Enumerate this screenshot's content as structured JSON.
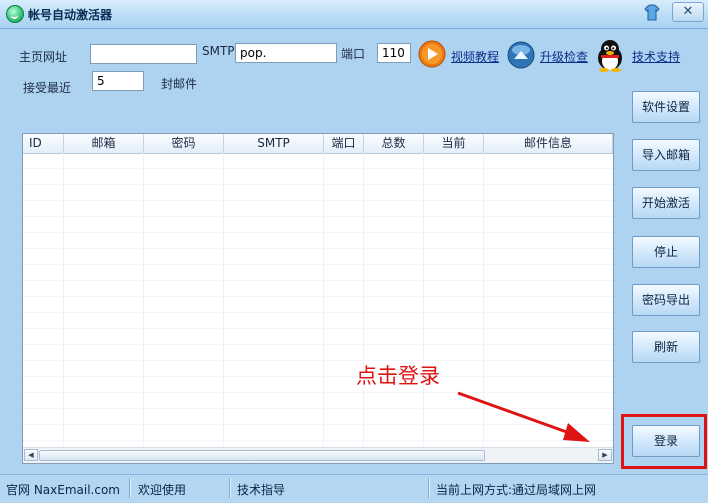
{
  "window": {
    "title": "帐号自动激活器",
    "close_label": "✕"
  },
  "form": {
    "homepage_label": "主页网址",
    "homepage_value": "",
    "smtp_label": "SMTP",
    "smtp_value": "pop.",
    "port_label": "端口",
    "port_value": "110",
    "receive_label": "接受最近",
    "receive_value": "5",
    "receive_unit": "封邮件"
  },
  "toolbar_links": {
    "video_tutorial": "视频教程",
    "upgrade_check": "升级检查",
    "tech_support": "技术支持"
  },
  "side_buttons": {
    "settings": "软件设置",
    "import": "导入邮箱",
    "start": "开始激活",
    "stop": "停止",
    "export": "密码导出",
    "refresh": "刷新",
    "login": "登录"
  },
  "grid": {
    "columns": [
      "ID",
      "邮箱",
      "密码",
      "SMTP",
      "端口",
      "总数",
      "当前",
      "邮件信息"
    ],
    "rows": []
  },
  "annotation": {
    "text": "点击登录",
    "color": "#e01313"
  },
  "statusbar": {
    "site": "官网 NaxEmail.com",
    "welcome": "欢迎使用",
    "guide": "技术指导",
    "network": "当前上网方式:通过局域网上网"
  }
}
